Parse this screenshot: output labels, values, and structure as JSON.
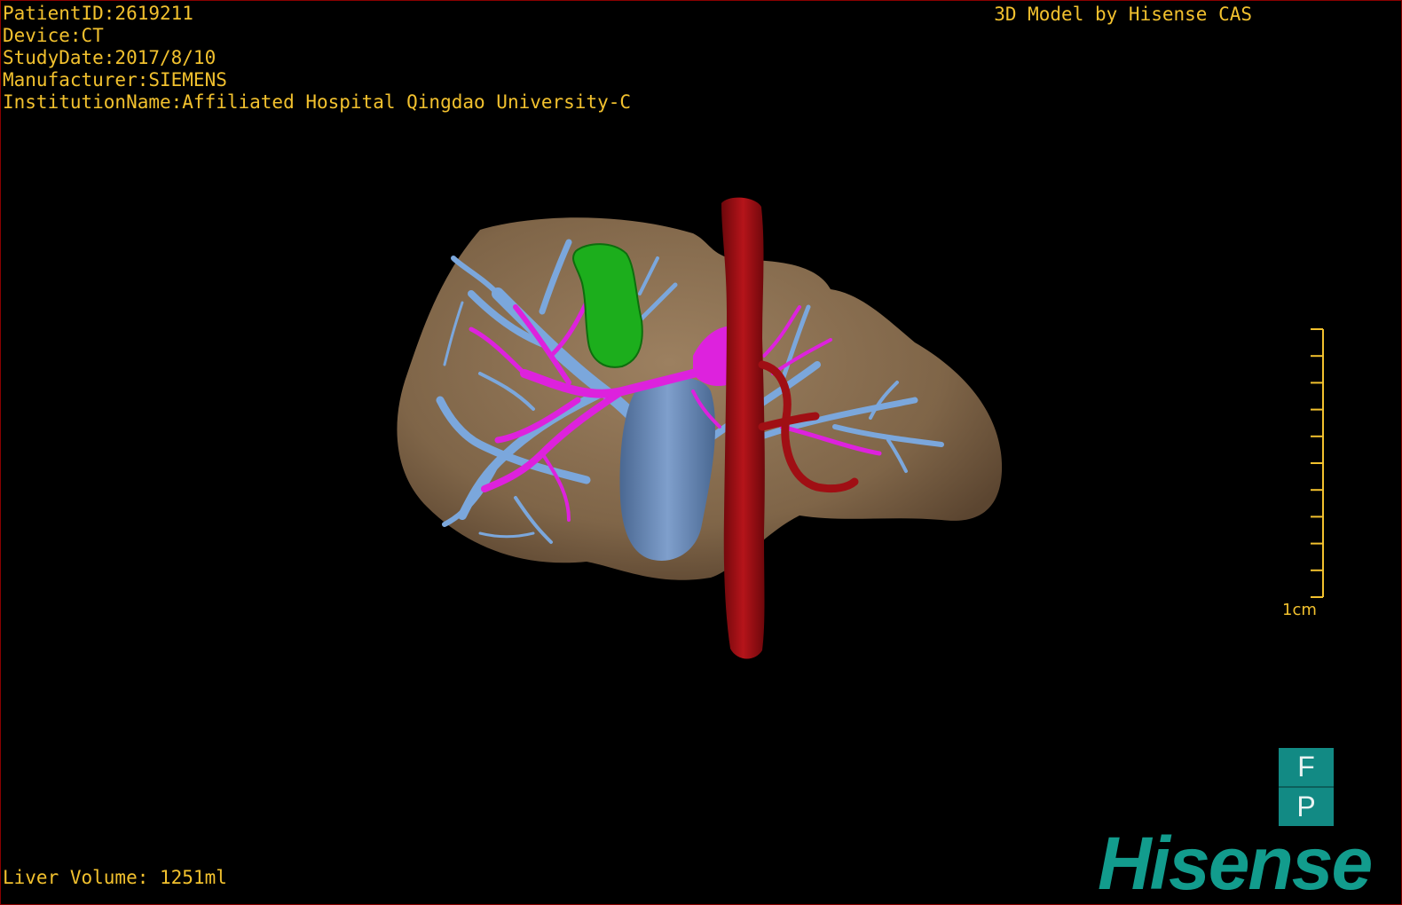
{
  "info": {
    "patient_id": "PatientID:2619211",
    "device": "Device:CT",
    "study_date": "StudyDate:2017/8/10",
    "manufacturer": "Manufacturer:SIEMENS",
    "institution": "InstitutionName:Affiliated Hospital Qingdao University-C"
  },
  "watermark": "3D Model by Hisense CAS",
  "liver_volume": "Liver Volume: 1251ml",
  "scale_bar": {
    "label": "1cm",
    "tick_count": 11
  },
  "orientation_cube": {
    "top": "F",
    "bottom": "P"
  },
  "logo": "Hisense",
  "colors": {
    "text": "#f2c12e",
    "liver": "#8b7253",
    "portal_vein": "#7ba7dc",
    "hepatic_artery": "#dd22dd",
    "tumor": "#1cae1c",
    "vena_cava": "#a00f14",
    "brand": "#129c8d"
  }
}
